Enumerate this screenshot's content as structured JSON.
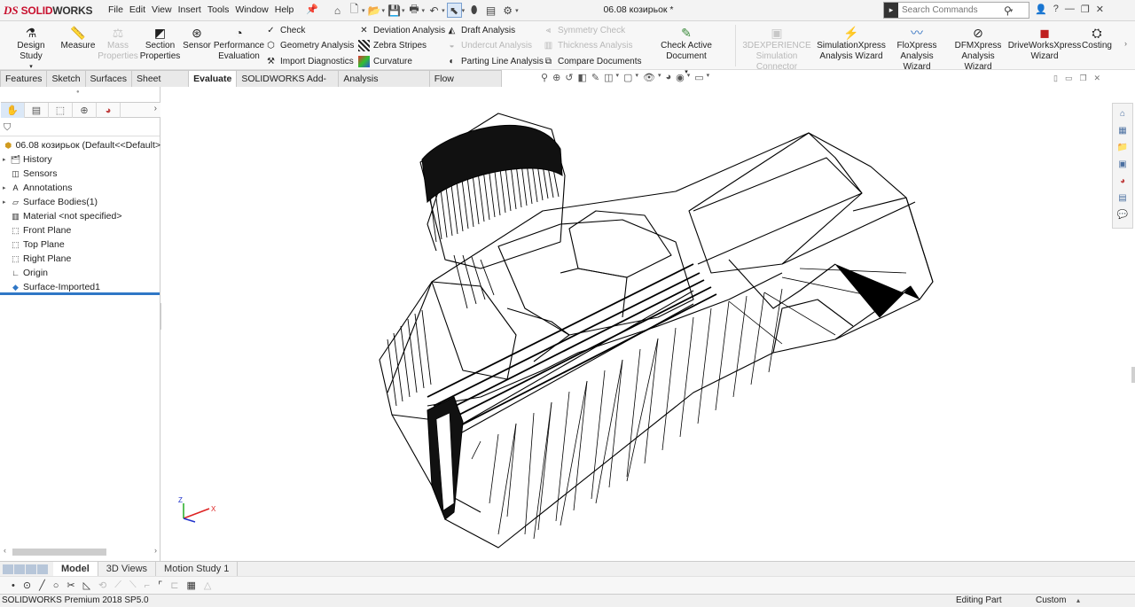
{
  "app": {
    "logo_ds": "DS",
    "logo_solid": "SOLID",
    "logo_works": "WORKS",
    "document_title": "06.08 козирьок *",
    "accent_color": "#c8102e",
    "selection_color": "#2f77c6"
  },
  "menu": [
    "File",
    "Edit",
    "View",
    "Insert",
    "Tools",
    "Window",
    "Help"
  ],
  "search": {
    "placeholder": "Search Commands"
  },
  "commands": {
    "design_study": "Design Study",
    "measure": "Measure",
    "mass_properties_1": "Mass",
    "mass_properties_2": "Properties",
    "section_properties_1": "Section",
    "section_properties_2": "Properties",
    "sensor": "Sensor",
    "performance_1": "Performance",
    "performance_2": "Evaluation",
    "check": "Check",
    "geometry_analysis": "Geometry Analysis",
    "import_diagnostics": "Import Diagnostics",
    "deviation_analysis": "Deviation Analysis",
    "zebra_stripes": "Zebra Stripes",
    "curvature": "Curvature",
    "draft_analysis": "Draft Analysis",
    "undercut_analysis": "Undercut Analysis",
    "parting_line_analysis": "Parting Line Analysis",
    "symmetry_check": "Symmetry Check",
    "thickness_analysis": "Thickness Analysis",
    "compare_documents": "Compare Documents",
    "check_active_document": "Check Active Document",
    "experience_1": "3DEXPERIENCE",
    "experience_2": "Simulation Connector",
    "simxpress_1": "SimulationXpress",
    "simxpress_2": "Analysis Wizard",
    "floxpress_1": "FloXpress",
    "floxpress_2": "Analysis Wizard",
    "dfmxpress_1": "DFMXpress",
    "dfmxpress_2": "Analysis Wizard",
    "driveworks_1": "DriveWorksXpress",
    "driveworks_2": "Wizard",
    "costing": "Costing"
  },
  "tabs": [
    "Features",
    "Sketch",
    "Surfaces",
    "Sheet Metal",
    "Evaluate",
    "SOLIDWORKS Add-Ins",
    "Analysis Preparation",
    "Flow Simulation"
  ],
  "active_tab": "Evaluate",
  "tree": {
    "root": "06.08 козирьок  (Default<<Default>",
    "items": [
      {
        "label": "History",
        "icon": "history-icon"
      },
      {
        "label": "Sensors",
        "icon": "sensors-icon"
      },
      {
        "label": "Annotations",
        "icon": "annotations-icon"
      },
      {
        "label": "Surface Bodies(1)",
        "icon": "surface-bodies-icon"
      },
      {
        "label": "Material <not specified>",
        "icon": "material-icon"
      },
      {
        "label": "Front Plane",
        "icon": "plane-icon"
      },
      {
        "label": "Top Plane",
        "icon": "plane-icon"
      },
      {
        "label": "Right Plane",
        "icon": "plane-icon"
      },
      {
        "label": "Origin",
        "icon": "origin-icon"
      },
      {
        "label": "Surface-Imported1",
        "icon": "surface-icon"
      }
    ]
  },
  "triad": {
    "x": "X",
    "y": "Y",
    "z": "Z"
  },
  "bottom_tabs": [
    "Model",
    "3D Views",
    "Motion Study 1"
  ],
  "status": {
    "product": "SOLIDWORKS Premium 2018 SP5.0",
    "mode": "Editing Part",
    "units": "Custom"
  }
}
